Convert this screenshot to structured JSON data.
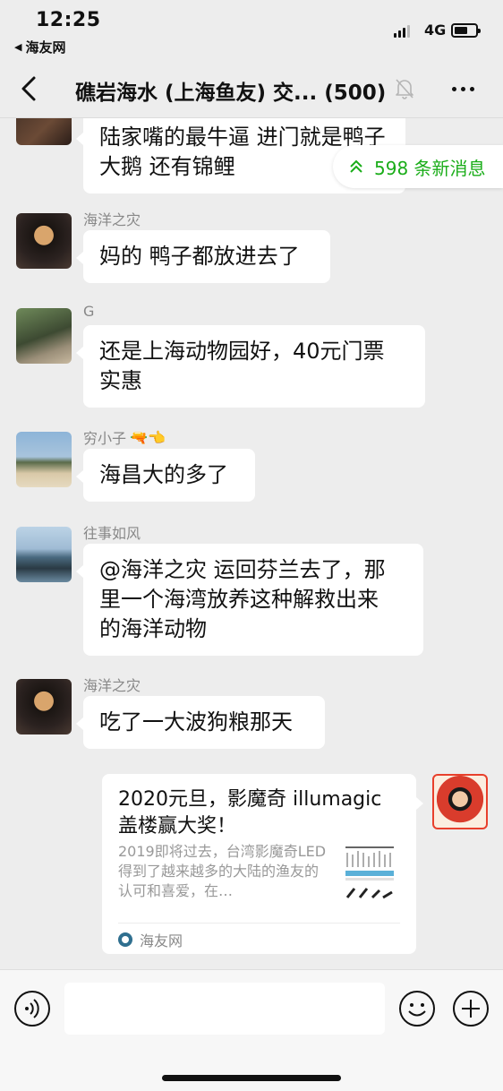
{
  "status_bar": {
    "time": "12:25",
    "back_app": "海友网",
    "network": "4G"
  },
  "nav": {
    "title": "礁岩海水 (上海鱼友) 交... (500)"
  },
  "new_messages_label": "598 条新消息",
  "messages": [
    {
      "sender": "",
      "line1": "陆家嘴的最牛逼 进门就是鸭子",
      "line2": "大鹅 还有锦鲤"
    },
    {
      "sender": "海洋之灾",
      "line1": "妈的 鸭子都放进去了"
    },
    {
      "sender": "G",
      "line1": "还是上海动物园好，40元门票",
      "line2": "实惠"
    },
    {
      "sender": "穷小子",
      "sender_emoji": "🔫👈",
      "line1": "海昌大的多了"
    },
    {
      "sender": "往事如风",
      "line1": "@海洋之灾 运回芬兰去了，那",
      "line2": "里一个海湾放养这种解救出来",
      "line3": "的海洋动物"
    },
    {
      "sender": "海洋之灾",
      "line1": "吃了一大波狗粮那天"
    }
  ],
  "link_card": {
    "title": "2020元旦，影魔奇 illumagic 盖楼赢大奖！",
    "description": "2019即将过去，台湾影魔奇LED得到了越来越多的大陆的渔友的认可和喜爱，在…",
    "source": "海友网"
  },
  "input": {
    "placeholder": ""
  },
  "colors": {
    "accent_green": "#1aad19",
    "chat_background": "#ededed",
    "bubble": "#ffffff"
  }
}
